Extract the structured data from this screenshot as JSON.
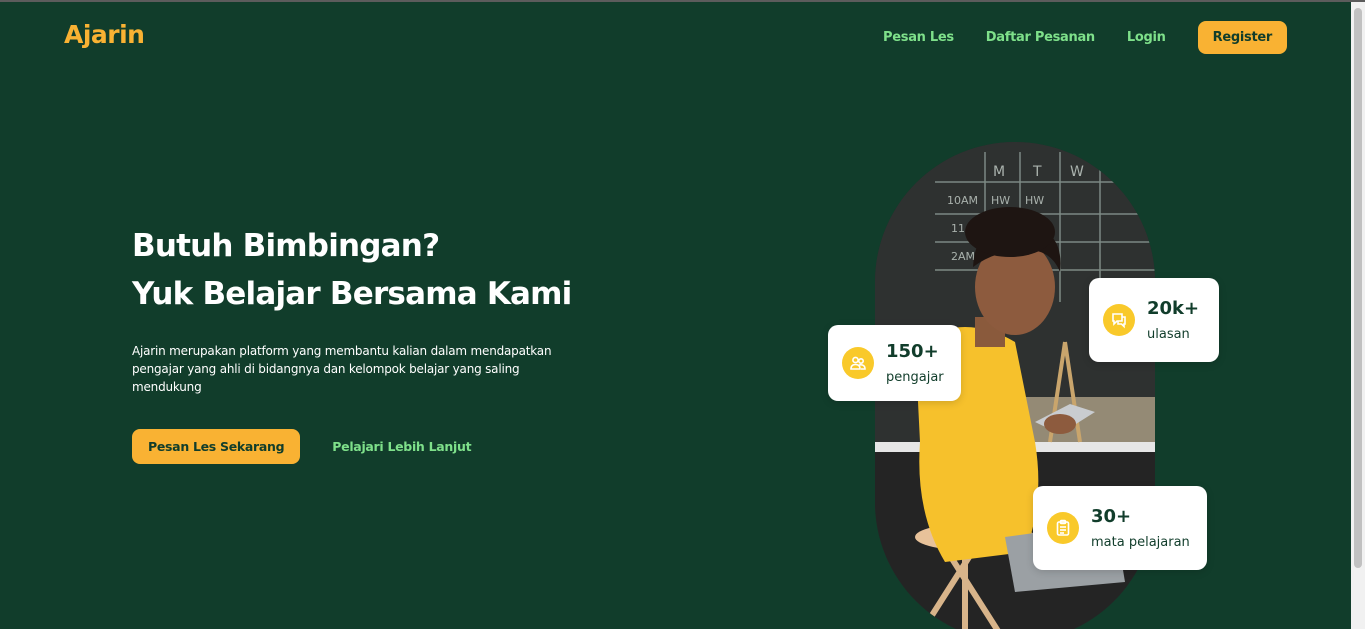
{
  "brand": {
    "logo": "Ajarin",
    "accent": "#f9b233",
    "background": "#113d2b",
    "link": "#7ee08a"
  },
  "nav": {
    "items": [
      "Pesan Les",
      "Daftar Pesanan",
      "Login"
    ],
    "register": "Register"
  },
  "hero": {
    "title_line1": "Butuh Bimbingan?",
    "title_line2": "Yuk Belajar Bersama Kami",
    "description": "Ajarin merupakan platform yang membantu kalian dalam mendapatkan pengajar yang ahli di bidangnya dan kelompok belajar yang saling mendukung",
    "primary_button": "Pesan Les Sekarang",
    "secondary_button": "Pelajari Lebih Lanjut"
  },
  "stats": [
    {
      "value": "150+",
      "label": "pengajar",
      "icon": "users-icon"
    },
    {
      "value": "20k+",
      "label": "ulasan",
      "icon": "chat-icon"
    },
    {
      "value": "30+",
      "label": "mata pelajaran",
      "icon": "clipboard-icon"
    }
  ]
}
